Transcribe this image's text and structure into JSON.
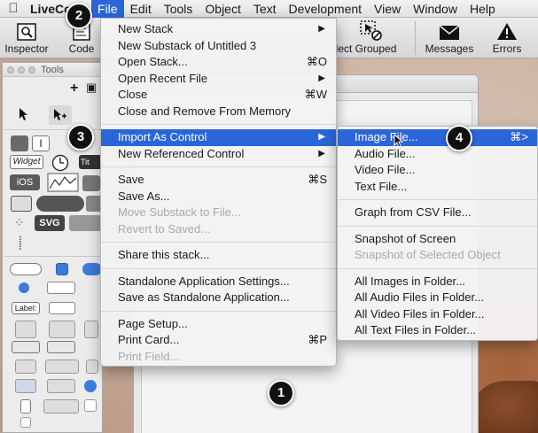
{
  "menubar": {
    "app_name": "LiveCode",
    "items": [
      "File",
      "Edit",
      "Tools",
      "Object",
      "Text",
      "Development",
      "View",
      "Window",
      "Help"
    ]
  },
  "toolbar": {
    "buttons": [
      {
        "label": "Inspector",
        "icon": "inspector-icon"
      },
      {
        "label": "Code",
        "icon": "code-icon"
      },
      {
        "label": "elect Grouped",
        "icon": "select-grouped-icon"
      },
      {
        "label": "Messages",
        "icon": "envelope-icon"
      },
      {
        "label": "Errors",
        "icon": "warning-icon"
      }
    ]
  },
  "tools_palette": {
    "title": "Tools",
    "labels": [
      "Widget",
      "Tit",
      "iOS",
      "SVG",
      "Label:"
    ]
  },
  "file_menu": {
    "items": [
      {
        "label": "New Stack",
        "shortcut": "",
        "submenu": true,
        "disabled": false
      },
      {
        "label": "New Substack of Untitled 3",
        "shortcut": "",
        "submenu": false,
        "disabled": false
      },
      {
        "label": "Open Stack...",
        "shortcut": "⌘O",
        "submenu": false,
        "disabled": false
      },
      {
        "label": "Open Recent File",
        "shortcut": "",
        "submenu": true,
        "disabled": false
      },
      {
        "label": "Close",
        "shortcut": "⌘W",
        "submenu": false,
        "disabled": false
      },
      {
        "label": "Close and Remove From Memory",
        "shortcut": "",
        "submenu": false,
        "disabled": false
      },
      {
        "sep": true
      },
      {
        "label": "Import As Control",
        "shortcut": "",
        "submenu": true,
        "disabled": false,
        "highlight": true
      },
      {
        "label": "New Referenced Control",
        "shortcut": "",
        "submenu": true,
        "disabled": false
      },
      {
        "sep": true
      },
      {
        "label": "Save",
        "shortcut": "⌘S",
        "submenu": false,
        "disabled": false
      },
      {
        "label": "Save As...",
        "shortcut": "",
        "submenu": false,
        "disabled": false
      },
      {
        "label": "Move Substack to File...",
        "shortcut": "",
        "submenu": false,
        "disabled": true
      },
      {
        "label": "Revert to Saved...",
        "shortcut": "",
        "submenu": false,
        "disabled": true
      },
      {
        "sep": true
      },
      {
        "label": "Share this stack...",
        "shortcut": "",
        "submenu": false,
        "disabled": false
      },
      {
        "sep": true
      },
      {
        "label": "Standalone Application Settings...",
        "shortcut": "",
        "submenu": false,
        "disabled": false
      },
      {
        "label": "Save as Standalone Application...",
        "shortcut": "",
        "submenu": false,
        "disabled": false
      },
      {
        "sep": true
      },
      {
        "label": "Page Setup...",
        "shortcut": "",
        "submenu": false,
        "disabled": false
      },
      {
        "label": "Print Card...",
        "shortcut": "⌘P",
        "submenu": false,
        "disabled": false
      },
      {
        "label": "Print Field...",
        "shortcut": "",
        "submenu": false,
        "disabled": true
      }
    ]
  },
  "import_submenu": {
    "items": [
      {
        "label": "Image File...",
        "shortcut": "⌘>",
        "highlight": true,
        "disabled": false
      },
      {
        "label": "Audio File...",
        "shortcut": "",
        "disabled": false
      },
      {
        "label": "Video File...",
        "shortcut": "",
        "disabled": false
      },
      {
        "label": "Text File...",
        "shortcut": "",
        "disabled": false
      },
      {
        "sep": true
      },
      {
        "label": "Graph from CSV File...",
        "shortcut": "",
        "disabled": false
      },
      {
        "sep": true
      },
      {
        "label": "Snapshot of Screen",
        "shortcut": "",
        "disabled": false
      },
      {
        "label": "Snapshot of Selected Object",
        "shortcut": "",
        "disabled": true
      },
      {
        "sep": true
      },
      {
        "label": "All Images in Folder...",
        "shortcut": "",
        "disabled": false
      },
      {
        "label": "All Audio Files in Folder...",
        "shortcut": "",
        "disabled": false
      },
      {
        "label": "All Video Files in Folder...",
        "shortcut": "",
        "disabled": false
      },
      {
        "label": "All Text Files in Folder...",
        "shortcut": "",
        "disabled": false
      }
    ]
  },
  "callouts": [
    "1",
    "2",
    "3",
    "4"
  ],
  "colors": {
    "highlight": "#2a66d9",
    "menubar": "#ececec",
    "disabled": "#a9a9a9"
  }
}
